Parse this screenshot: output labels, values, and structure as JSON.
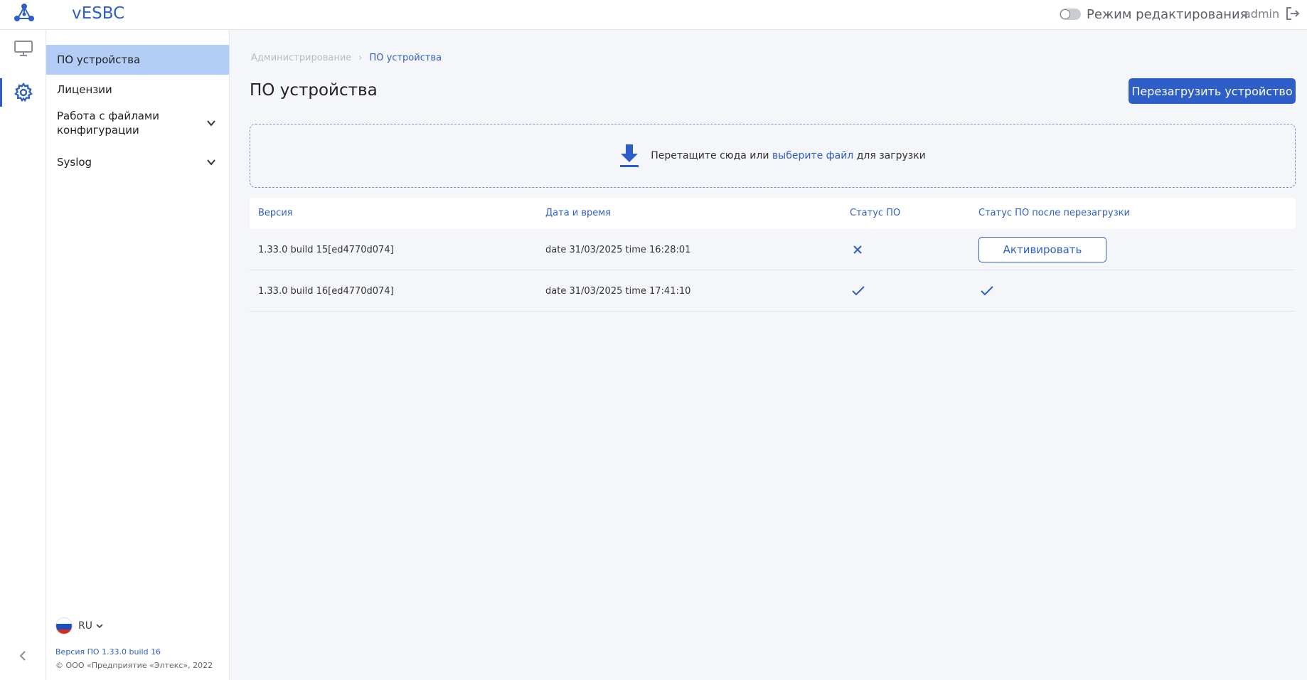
{
  "header": {
    "app_title": "vESBC",
    "edit_mode_label": "Режим редактирования",
    "edit_mode_on": false,
    "user": "admin"
  },
  "rail": {
    "items": [
      "monitor-icon",
      "gear-icon"
    ],
    "active": "gear-icon"
  },
  "sidebar": {
    "items": [
      {
        "label": "ПО устройства",
        "active": true
      },
      {
        "label": "Лицензии"
      },
      {
        "label": "Работа с файлами конфигурации",
        "expandable": true
      },
      {
        "label": "Syslog",
        "expandable": true
      }
    ],
    "language": "RU",
    "sw_version": "Версия ПО 1.33.0 build 16",
    "copyright": "© ООО «Предприятие «Элтекс», 2022"
  },
  "breadcrumb": {
    "root": "Администрирование",
    "separator": "›",
    "current": "ПО устройства"
  },
  "page": {
    "title": "ПО устройства",
    "reboot_button": "Перезагрузить устройство"
  },
  "dropzone": {
    "text_before": "Перетащите сюда или ",
    "link": "выберите файл",
    "text_after": " для загрузки"
  },
  "table": {
    "columns": [
      "Версия",
      "Дата и время",
      "Статус ПО",
      "Статус ПО после перезагрузки"
    ],
    "rows": [
      {
        "version": "1.33.0 build 15[ed4770d074]",
        "datetime": "date 31/03/2025 time 16:28:01",
        "status": "cross-icon",
        "after_reboot": "Активировать"
      },
      {
        "version": "1.33.0 build 16[ed4770d074]",
        "datetime": "date 31/03/2025 time 17:41:10",
        "status": "check-icon",
        "after_reboot": "check-icon"
      }
    ]
  },
  "colors": {
    "accent": "#2e5fc8",
    "active_nav": "#b4cdf7",
    "background": "#f4f6f9"
  }
}
